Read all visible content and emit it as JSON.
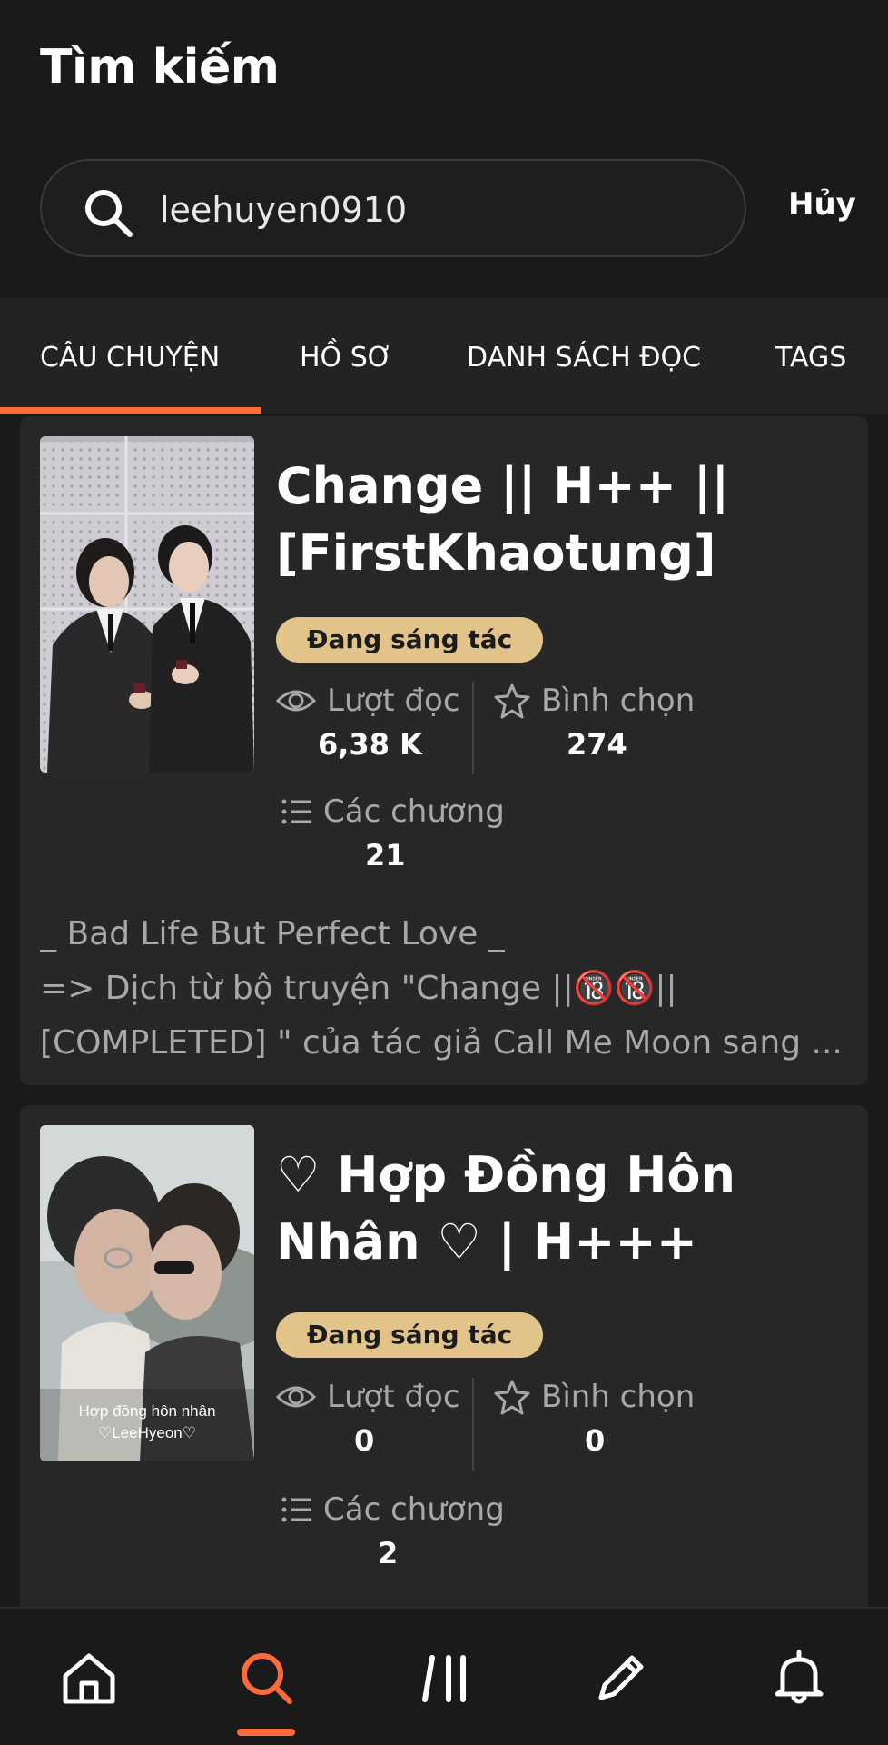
{
  "header": {
    "title": "Tìm kiếm",
    "cancel_label": "Hủy"
  },
  "search": {
    "value": "leehuyen0910",
    "icon": "search-icon"
  },
  "tabs": [
    {
      "label": "CÂU CHUYỆN",
      "active": true
    },
    {
      "label": "HỒ SƠ",
      "active": false
    },
    {
      "label": "DANH SÁCH ĐỌC",
      "active": false
    },
    {
      "label": "TAGS",
      "active": false
    }
  ],
  "stories": [
    {
      "title": "Change || H++ || [FirstKhaotung]",
      "status": "Đang sáng tác",
      "reads_label": "Lượt đọc",
      "reads": "6,38 K",
      "votes_label": "Bình chọn",
      "votes": "274",
      "chapters_label": "Các chương",
      "chapters": "21",
      "description": [
        "_ Bad Life But Perfect Love _",
        "=> Dịch từ bộ truyện \"Change ||🔞🔞||",
        "[COMPLETED] \" của tác giả Call Me Moon sang ..."
      ]
    },
    {
      "title": "♡ Hợp Đồng Hôn Nhân ♡ | H+++",
      "status": "Đang sáng tác",
      "reads_label": "Lượt đọc",
      "reads": "0",
      "votes_label": "Bình chọn",
      "votes": "0",
      "chapters_label": "Các chương",
      "chapters": "2",
      "cover_caption": [
        "Hợp đồng hôn nhân",
        "♡LeeHyeon♡"
      ]
    }
  ],
  "bottom_nav": [
    {
      "icon": "home-icon",
      "active": false
    },
    {
      "icon": "search-icon",
      "active": true
    },
    {
      "icon": "library-icon",
      "active": false
    },
    {
      "icon": "pencil-icon",
      "active": false
    },
    {
      "icon": "bell-icon",
      "active": false
    }
  ],
  "colors": {
    "background": "#1a1a1a",
    "card": "#272727",
    "accent": "#ff6a3a",
    "badge": "#e2c48a"
  }
}
